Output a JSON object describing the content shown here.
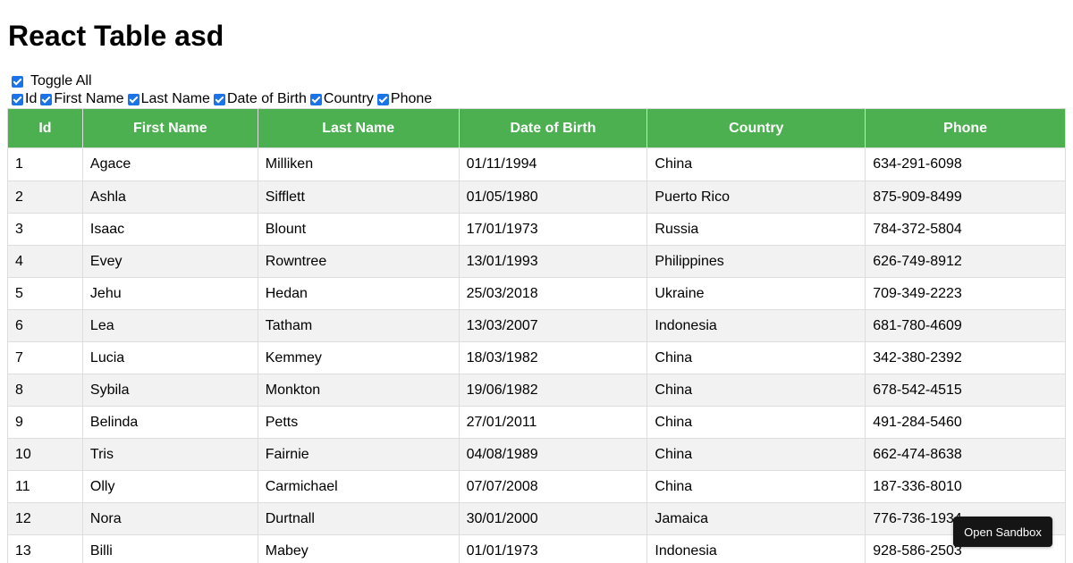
{
  "title": "React Table asd",
  "toggle_all_label": "Toggle All",
  "columns": [
    "Id",
    "First Name",
    "Last Name",
    "Date of Birth",
    "Country",
    "Phone"
  ],
  "rows": [
    [
      "1",
      "Agace",
      "Milliken",
      "01/11/1994",
      "China",
      "634-291-6098"
    ],
    [
      "2",
      "Ashla",
      "Sifflett",
      "01/05/1980",
      "Puerto Rico",
      "875-909-8499"
    ],
    [
      "3",
      "Isaac",
      "Blount",
      "17/01/1973",
      "Russia",
      "784-372-5804"
    ],
    [
      "4",
      "Evey",
      "Rowntree",
      "13/01/1993",
      "Philippines",
      "626-749-8912"
    ],
    [
      "5",
      "Jehu",
      "Hedan",
      "25/03/2018",
      "Ukraine",
      "709-349-2223"
    ],
    [
      "6",
      "Lea",
      "Tatham",
      "13/03/2007",
      "Indonesia",
      "681-780-4609"
    ],
    [
      "7",
      "Lucia",
      "Kemmey",
      "18/03/1982",
      "China",
      "342-380-2392"
    ],
    [
      "8",
      "Sybila",
      "Monkton",
      "19/06/1982",
      "China",
      "678-542-4515"
    ],
    [
      "9",
      "Belinda",
      "Petts",
      "27/01/2011",
      "China",
      "491-284-5460"
    ],
    [
      "10",
      "Tris",
      "Fairnie",
      "04/08/1989",
      "China",
      "662-474-8638"
    ],
    [
      "11",
      "Olly",
      "Carmichael",
      "07/07/2008",
      "China",
      "187-336-8010"
    ],
    [
      "12",
      "Nora",
      "Durtnall",
      "30/01/2000",
      "Jamaica",
      "776-736-1934"
    ],
    [
      "13",
      "Billi",
      "Mabey",
      "01/01/1973",
      "Indonesia",
      "928-586-2503"
    ]
  ],
  "open_sandbox_label": "Open Sandbox",
  "colors": {
    "header_bg": "#4caf50",
    "header_text": "#ffffff",
    "row_stripe": "#f2f2f2",
    "checkbox": "#1a73e8",
    "sandbox_button": "#151515"
  }
}
